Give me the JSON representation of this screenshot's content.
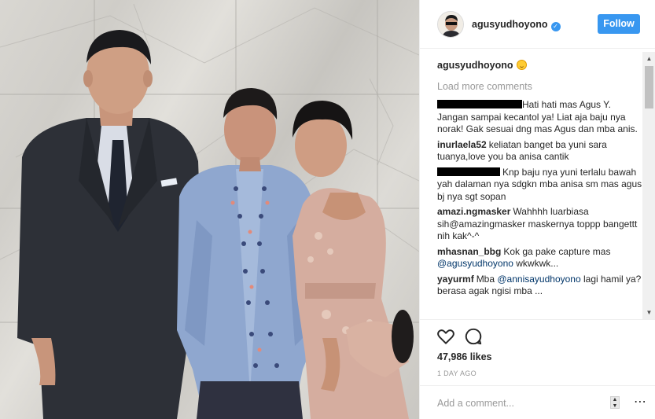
{
  "post": {
    "username": "agusyudhoyono",
    "follow_label": "Follow",
    "caption_user": "agusyudhoyono",
    "load_more": "Load more comments",
    "likes": "47,986 likes",
    "timestamp": "1 DAY AGO",
    "add_comment_placeholder": "Add a comment...",
    "more_symbol": "⋯"
  },
  "comments": [
    {
      "user": "",
      "redacted": true,
      "text": "Hati hati mas Agus Y. Jangan sampai kecantol ya! Liat aja baju nya norak! Gak sesuai dng mas Agus dan mba anis."
    },
    {
      "user": "inurlaela52",
      "text": "keliatan banget ba yuni sara tuanya,love you ba anisa cantik"
    },
    {
      "user": "",
      "redacted": true,
      "text": "Knp baju nya yuni terlalu bawah yah dalaman nya sdgkn mba anisa sm mas agus bj nya sgt sopan"
    },
    {
      "user": "amazi.ngmasker",
      "text": "Wahhhh luarbiasa sih@amazingmasker maskernya toppp bangettt nih kak^-^"
    },
    {
      "user": "mhasnan_bbg",
      "text": "Kok ga pake capture mas",
      "mention": "@agusyudhoyono",
      "after": " wkwkwk..."
    },
    {
      "user": "yayurmf",
      "text": "Mba",
      "mention": "@annisayudhoyono",
      "after": " lagi hamil ya?berasa agak ngisi mba ..."
    }
  ],
  "icons": {
    "verified": "verified-badge-icon",
    "like": "heart-icon",
    "comment": "comment-bubble-icon",
    "emoji": "smile-emoji-icon"
  },
  "colors": {
    "accent": "#3897f0",
    "muted": "#999999",
    "mention": "#003569"
  }
}
